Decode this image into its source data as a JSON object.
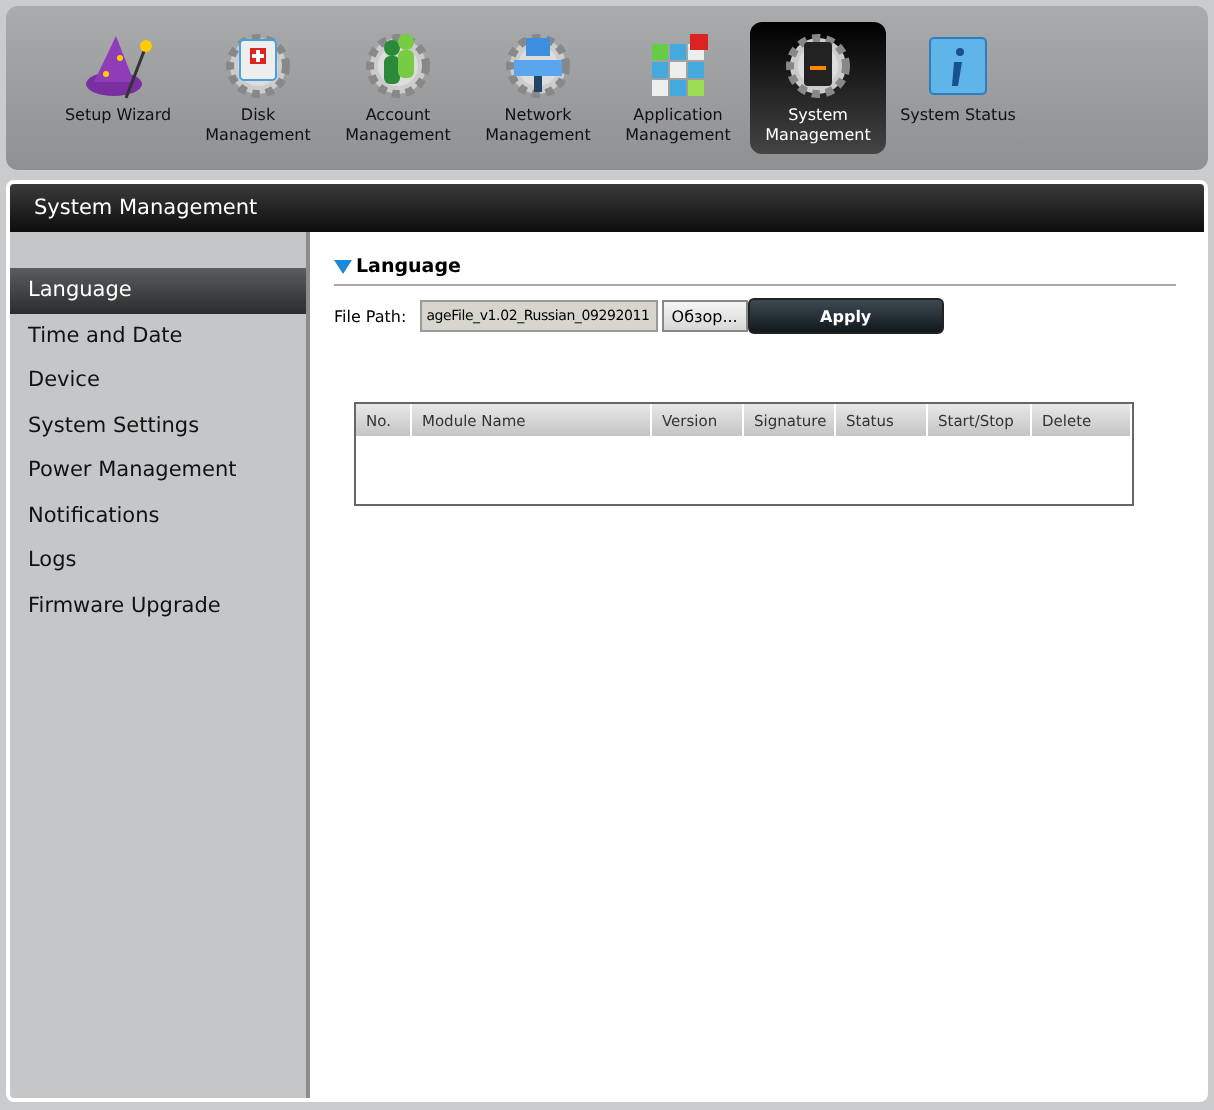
{
  "toolbar": [
    {
      "label": "Setup Wizard",
      "kind": "wizard",
      "selected": false
    },
    {
      "label": "Disk Management",
      "kind": "disk",
      "selected": false
    },
    {
      "label": "Account Management",
      "kind": "account",
      "selected": false
    },
    {
      "label": "Network Management",
      "kind": "network",
      "selected": false
    },
    {
      "label": "Application Management",
      "kind": "apps",
      "selected": false
    },
    {
      "label": "System Management",
      "kind": "system",
      "selected": true
    },
    {
      "label": "System Status",
      "kind": "info",
      "selected": false
    }
  ],
  "panel": {
    "title": "System Management"
  },
  "sidebar": {
    "items": [
      {
        "label": "Language",
        "selected": true
      },
      {
        "label": "Time and Date",
        "selected": false
      },
      {
        "label": "Device",
        "selected": false
      },
      {
        "label": "System Settings",
        "selected": false
      },
      {
        "label": "Power Management",
        "selected": false
      },
      {
        "label": "Notifications",
        "selected": false
      },
      {
        "label": "Logs",
        "selected": false
      },
      {
        "label": "Firmware Upgrade",
        "selected": false
      }
    ]
  },
  "section": {
    "title": "Language",
    "expanded": true
  },
  "file_path": {
    "label": "File Path:",
    "value": "ageFile_v1.02_Russian_09292011",
    "browse": "Обзор...",
    "apply": "Apply"
  },
  "table": {
    "columns": [
      "No.",
      "Module Name",
      "Version",
      "Signature",
      "Status",
      "Start/Stop",
      "Delete"
    ]
  }
}
